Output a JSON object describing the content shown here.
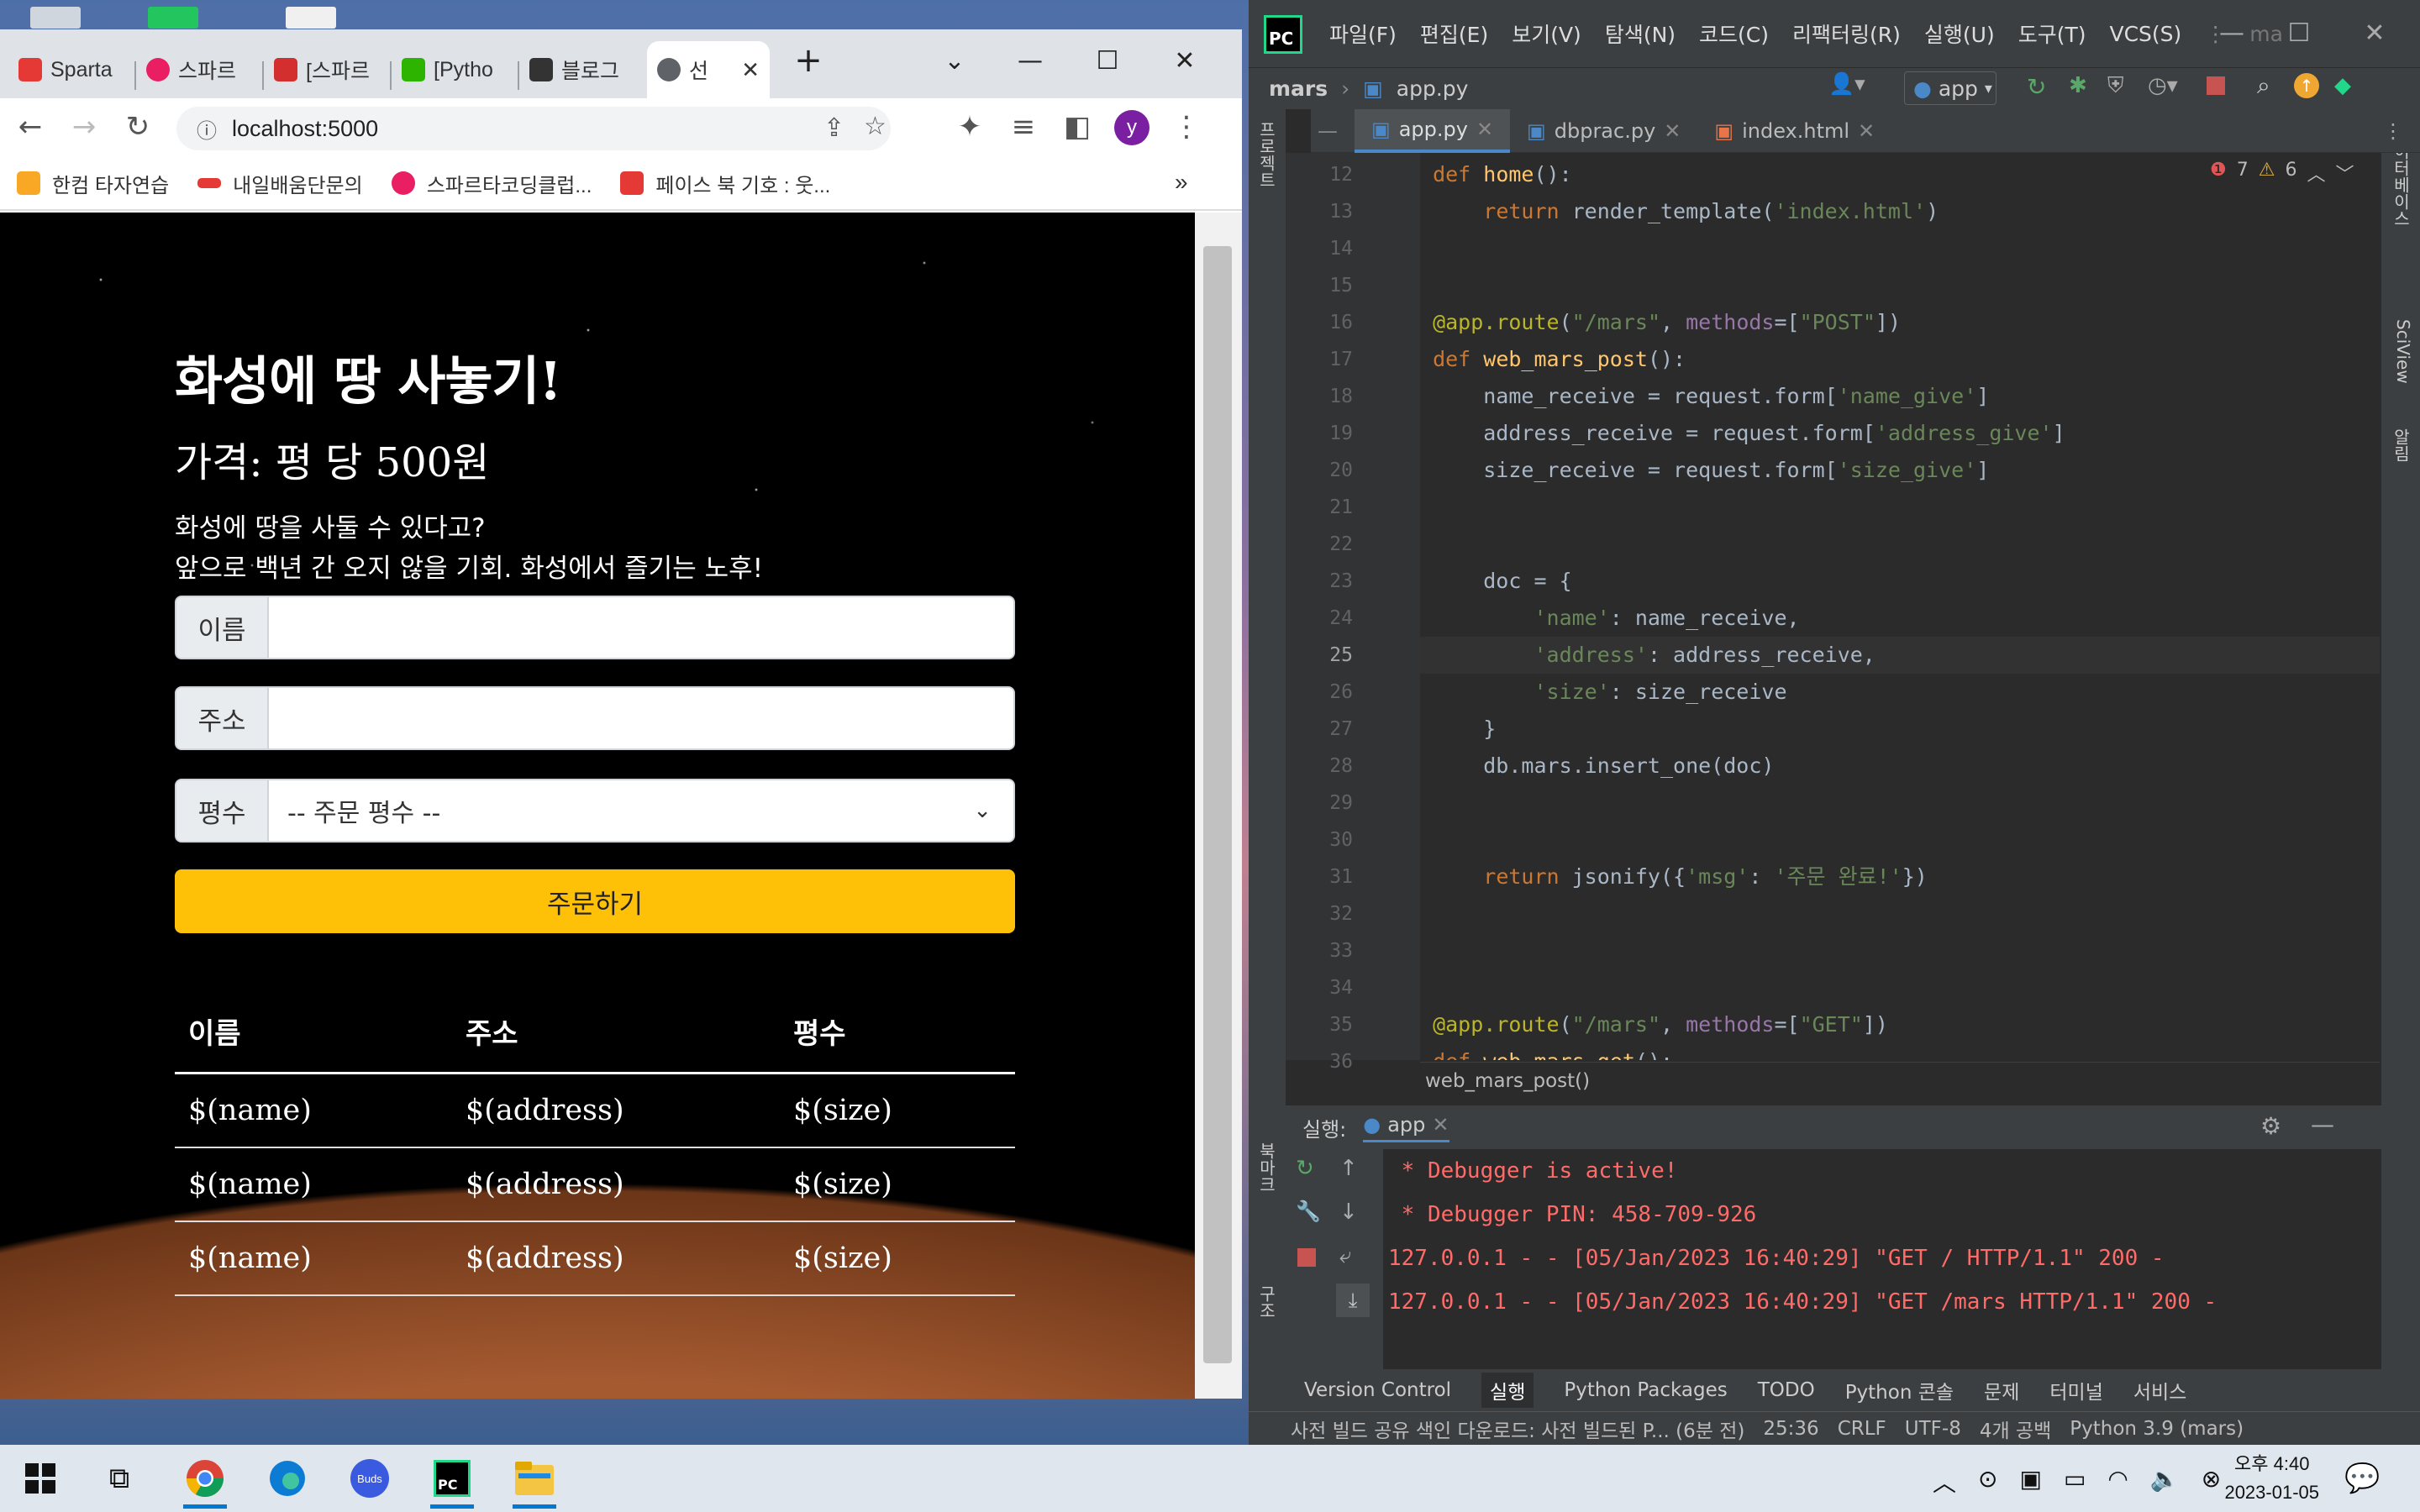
{
  "browser": {
    "tabs": [
      {
        "label": "Sparta",
        "color": "#e53935"
      },
      {
        "label": "스파르",
        "color": "#e91e63"
      },
      {
        "label": "[스파르",
        "color": "#d32f2f"
      },
      {
        "label": "[Pytho",
        "color": "#2db400"
      },
      {
        "label": "블로그",
        "color": "#333333"
      },
      {
        "label": "선",
        "color": "#5f6368"
      }
    ],
    "url": "localhost:5000",
    "profile_initial": "y",
    "bookmarks": [
      {
        "label": "한컴 타자연습",
        "color": "#f9a825"
      },
      {
        "label": "내일배움단문의",
        "color": "#e53935"
      },
      {
        "label": "스파르타코딩클럽...",
        "color": "#e91e63"
      },
      {
        "label": "페이스 북 기호 : 웃...",
        "color": "#e53935"
      }
    ],
    "bookmarks_more": "»"
  },
  "page": {
    "title": "화성에 땅 사놓기!",
    "price": "가격: 평 당 500원",
    "desc_line1": "화성에 땅을 사둘 수 있다고?",
    "desc_line2": "앞으로 백년 간 오지 않을 기회. 화성에서 즐기는 노후!",
    "name_label": "이름",
    "address_label": "주소",
    "size_label": "평수",
    "size_select_value": "-- 주문 평수 --",
    "order_button": "주문하기",
    "table_headers": [
      "이름",
      "주소",
      "평수"
    ],
    "table_rows": [
      [
        "$(name)",
        "$(address)",
        "$(size)"
      ],
      [
        "$(name)",
        "$(address)",
        "$(size)"
      ],
      [
        "$(name)",
        "$(address)",
        "$(size)"
      ]
    ]
  },
  "ide": {
    "menu": [
      "파일(F)",
      "편집(E)",
      "보기(V)",
      "탐색(N)",
      "코드(C)",
      "리팩터링(R)",
      "실행(U)",
      "도구(T)",
      "VCS(S)",
      "ma"
    ],
    "logo": "PC",
    "project": "mars",
    "nav_file": "app.py",
    "run_config": "app",
    "editor_tabs": [
      "app.py",
      "dbprac.py",
      "index.html"
    ],
    "inspections": {
      "errors": "7",
      "warnings": "6"
    },
    "code_lines": [
      {
        "n": "12",
        "html": "<span class='kw'>def</span> <span class='fn'>home</span>():"
      },
      {
        "n": "13",
        "html": "    <span class='kw'>return</span> render_template(<span class='st'>'index.html'</span>)"
      },
      {
        "n": "14",
        "html": ""
      },
      {
        "n": "15",
        "html": ""
      },
      {
        "n": "16",
        "html": "<span class='dec'>@app.route</span>(<span class='st'>\"/mars\"</span>, <span class='pu'>methods</span>=[<span class='st'>\"POST\"</span>])"
      },
      {
        "n": "17",
        "html": "<span class='kw'>def</span> <span class='fn'>web_mars_post</span>():"
      },
      {
        "n": "18",
        "html": "    name_receive = request.form[<span class='st'>'name_give'</span>]"
      },
      {
        "n": "19",
        "html": "    address_receive = request.form[<span class='st'>'address_give'</span>]"
      },
      {
        "n": "20",
        "html": "    size_receive = request.form[<span class='st'>'size_give'</span>]"
      },
      {
        "n": "21",
        "html": ""
      },
      {
        "n": "22",
        "html": ""
      },
      {
        "n": "23",
        "html": "    doc = {"
      },
      {
        "n": "24",
        "html": "        <span class='st'>'name'</span>: name_receive,"
      },
      {
        "n": "25",
        "html": "        <span class='st'>'address'</span>: address_receive,"
      },
      {
        "n": "26",
        "html": "        <span class='st'>'size'</span>: size_receive"
      },
      {
        "n": "27",
        "html": "    }"
      },
      {
        "n": "28",
        "html": "    db.mars.insert_one(doc)"
      },
      {
        "n": "29",
        "html": ""
      },
      {
        "n": "30",
        "html": ""
      },
      {
        "n": "31",
        "html": "    <span class='kw'>return</span> jsonify({<span class='st'>'msg'</span>: <span class='st'>'주문 완료!'</span>})"
      },
      {
        "n": "32",
        "html": ""
      },
      {
        "n": "33",
        "html": ""
      },
      {
        "n": "34",
        "html": ""
      },
      {
        "n": "35",
        "html": "<span class='dec'>@app.route</span>(<span class='st'>\"/mars\"</span>, <span class='pu'>methods</span>=[<span class='st'>\"GET\"</span>])"
      },
      {
        "n": "36",
        "html": "<span class='kw'>def</span> <span class='fn'>web_mars_get</span>():"
      }
    ],
    "current_line": "25",
    "breadcrumb_fn": "web_mars_post()",
    "run_label": "실행:",
    "run_tab": "app",
    "run_output": [
      " * Debugger is active!",
      " * Debugger PIN: 458-709-926",
      "127.0.0.1 - - [05/Jan/2023 16:40:29] \"GET / HTTP/1.1\" 200 -",
      "127.0.0.1 - - [05/Jan/2023 16:40:29] \"GET /mars HTTP/1.1\" 200 -"
    ],
    "bottom_tabs": [
      "Version Control",
      "실행",
      "Python Packages",
      "TODO",
      "Python 콘솔",
      "문제",
      "터미널",
      "서비스"
    ],
    "status": {
      "message": "사전 빌드 공유 색인 다운로드: 사전 빌드된 P... (6분 전)",
      "position": "25:36",
      "line_sep": "CRLF",
      "encoding": "UTF-8",
      "indent": "4개 공백",
      "interpreter": "Python 3.9 (mars)"
    },
    "side_labels": {
      "left_top": "프로젝트",
      "left_bottom1": "북마크",
      "left_bottom2": "구조",
      "right1": "데이터베이스",
      "right2": "SciView",
      "right3": "알림"
    }
  },
  "taskbar": {
    "time": "오후 4:40",
    "date": "2023-01-05",
    "buds_label": "Buds"
  }
}
